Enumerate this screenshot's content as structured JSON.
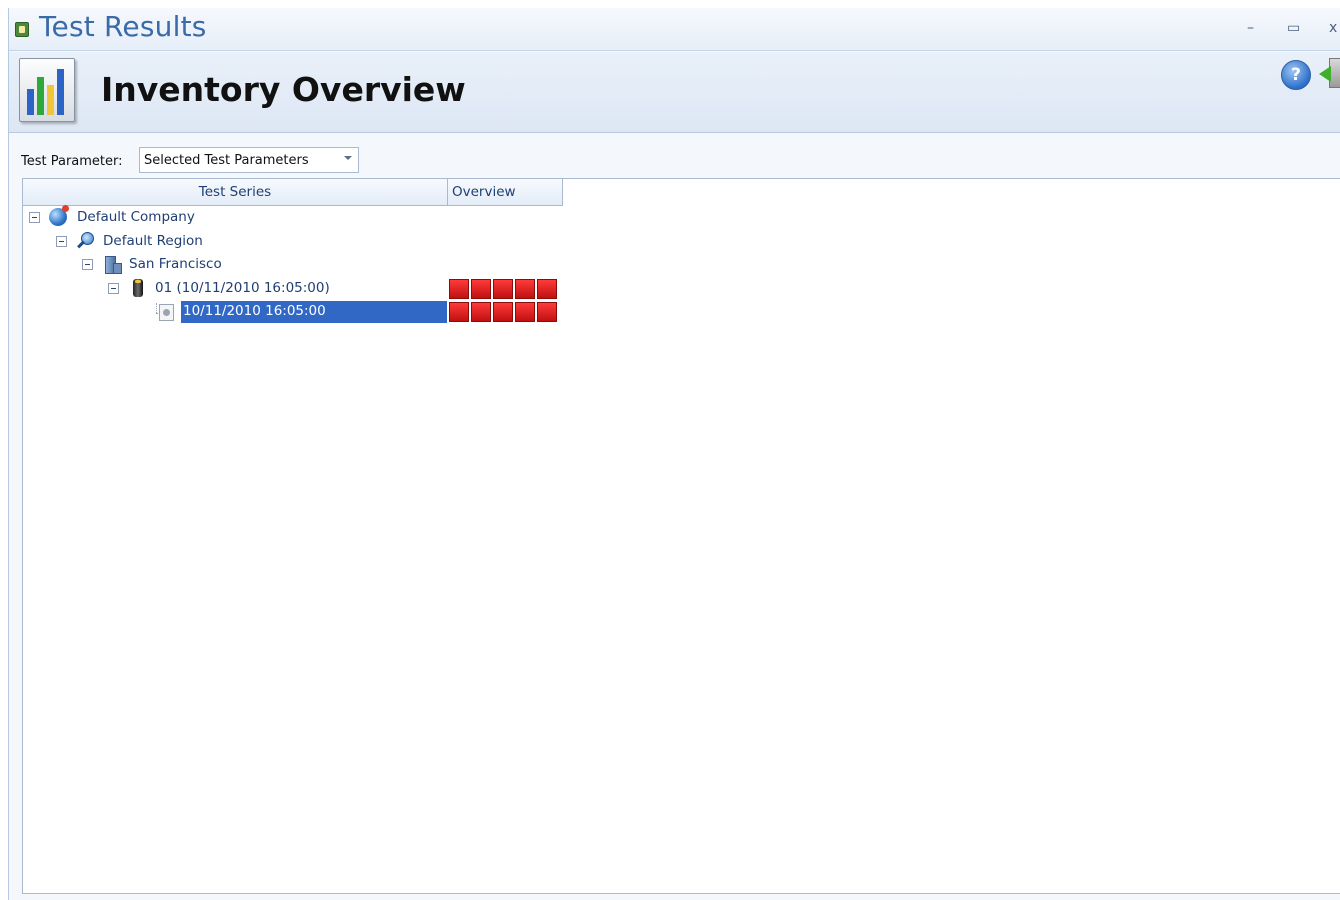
{
  "window": {
    "title": "Test Results",
    "controls": {
      "minimize": "–",
      "maximize": "▭",
      "close": "x"
    }
  },
  "header": {
    "title": "Inventory Overview",
    "icons": [
      "bar-chart-icon",
      "help-icon",
      "exit-icon"
    ],
    "help_glyph": "?"
  },
  "filter": {
    "label": "Test Parameter:",
    "selected": "Selected Test Parameters"
  },
  "grid": {
    "columns": [
      "Test Series",
      "Overview"
    ],
    "rows": [
      {
        "label": "Default Company",
        "icon": "globe-icon",
        "level": 0,
        "expanded": true,
        "overview_cells": 0,
        "selected": false
      },
      {
        "label": "Default Region",
        "icon": "magnifier-icon",
        "level": 1,
        "expanded": true,
        "overview_cells": 0,
        "selected": false
      },
      {
        "label": "San Francisco",
        "icon": "building-icon",
        "level": 2,
        "expanded": true,
        "overview_cells": 0,
        "selected": false
      },
      {
        "label": "01 (10/11/2010 16:05:00)",
        "icon": "cylinder-icon",
        "level": 3,
        "expanded": true,
        "overview_cells": 5,
        "selected": false
      },
      {
        "label": "10/11/2010 16:05:00",
        "icon": "document-icon",
        "level": 4,
        "expanded": false,
        "overview_cells": 5,
        "selected": true
      }
    ],
    "overview_color": "#e01818",
    "selection_color": "#3168c6"
  }
}
